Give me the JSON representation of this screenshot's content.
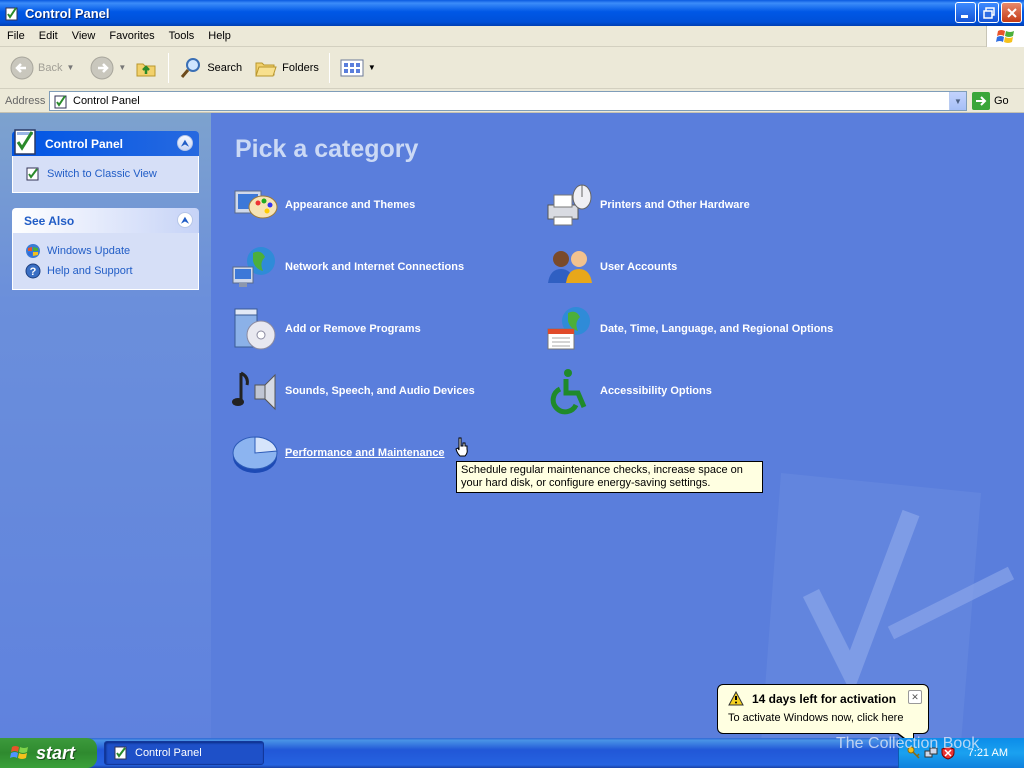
{
  "window": {
    "title": "Control Panel"
  },
  "menu": {
    "items": [
      "File",
      "Edit",
      "View",
      "Favorites",
      "Tools",
      "Help"
    ]
  },
  "toolbar": {
    "back_label": "Back",
    "search_label": "Search",
    "folders_label": "Folders"
  },
  "address": {
    "label": "Address",
    "value": "Control Panel",
    "go_label": "Go"
  },
  "sidebar": {
    "control_panel": {
      "title": "Control Panel",
      "tasks": [
        "Switch to Classic View"
      ]
    },
    "see_also": {
      "title": "See Also",
      "links": [
        "Windows Update",
        "Help and Support"
      ]
    }
  },
  "main": {
    "heading": "Pick a category",
    "categories": [
      "Appearance and Themes",
      "Printers and Other Hardware",
      "Network and Internet Connections",
      "User Accounts",
      "Add or Remove Programs",
      "Date, Time, Language, and Regional Options",
      "Sounds, Speech, and Audio Devices",
      "Accessibility Options",
      "Performance and Maintenance"
    ],
    "tooltip": "Schedule regular maintenance checks, increase space on your hard disk, or configure energy-saving settings."
  },
  "balloon": {
    "title": "14 days left for activation",
    "text": "To activate Windows now, click here"
  },
  "taskbar": {
    "start_label": "start",
    "window_button": "Control Panel",
    "clock": "7:21 AM"
  },
  "watermark": {
    "text": "The Collection Book"
  },
  "colors": {
    "content_bg": "#5a7edc",
    "titlebar": "#0058e6",
    "link": "#215dc6",
    "start_green": "#3c9a3c"
  }
}
